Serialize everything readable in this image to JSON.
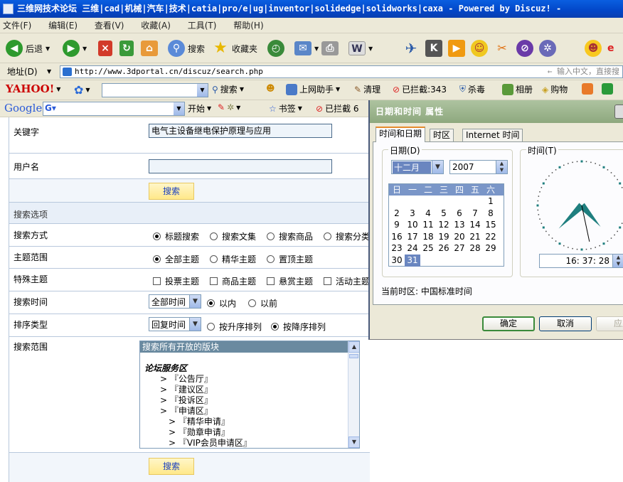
{
  "window": {
    "title": "三维网技术论坛 三维|cad|机械|汽车|技术|catia|pro/e|ug|inventor|solidedge|solidworks|caxa - Powered by Discuz! -"
  },
  "menu": {
    "items": [
      "文件(F)",
      "编辑(E)",
      "查看(V)",
      "收藏(A)",
      "工具(T)",
      "帮助(H)"
    ]
  },
  "toolbar": {
    "back": "后退",
    "search": "搜索",
    "favorites": "收藏夹"
  },
  "address": {
    "label": "地址(D)",
    "url": "http://www.3dportal.cn/discuz/search.php",
    "hint": "输入中文，直接搜"
  },
  "yahoo": {
    "logo": "YAHOO!",
    "search": "搜索",
    "assistant": "上网助手",
    "clean": "清理",
    "blocked": "已拦截:343",
    "antivirus": "杀毒",
    "album": "相册",
    "shop": "购物"
  },
  "google": {
    "logo": "Google",
    "start": "开始",
    "bookmarks": "书签",
    "blocked": "已拦截 6"
  },
  "form": {
    "keyword_label": "关键字",
    "keyword_value": "电气主设备继电保护原理与应用",
    "username_label": "用户名",
    "username_value": "",
    "search_button": "搜索",
    "options_heading": "搜索选项",
    "method_label": "搜索方式",
    "method_options": [
      "标题搜索",
      "搜索文集",
      "搜索商品",
      "搜索分类"
    ],
    "scope_label": "主题范围",
    "scope_options": [
      "全部主题",
      "精华主题",
      "置顶主题"
    ],
    "special_label": "特殊主题",
    "special_options": [
      "投票主题",
      "商品主题",
      "悬赏主题",
      "活动主题"
    ],
    "time_label": "搜索时间",
    "time_value": "全部时间",
    "time_within": "以内",
    "time_before": "以前",
    "sort_label": "排序类型",
    "sort_value": "回复时间",
    "sort_asc": "按升序排列",
    "sort_desc": "按降序排列",
    "range_label": "搜索范围",
    "range_list": {
      "header": "搜索所有开放的版块",
      "group": "论坛服务区",
      "items": [
        "> 『公告厅』",
        "> 『建议区』",
        "> 『投诉区』",
        "> 『申请区』"
      ],
      "subitems": [
        "> 『精华申请』",
        "> 『勋章申请』",
        "> 『VIP会员申请区』"
      ]
    },
    "bottom_button": "搜索"
  },
  "dialog": {
    "title": "日期和时间 属性",
    "tabs": [
      "时间和日期",
      "时区",
      "Internet 时间"
    ],
    "date_group": "日期(D)",
    "month": "十二月",
    "year": "2007",
    "weekdays": [
      "日",
      "一",
      "二",
      "三",
      "四",
      "五",
      "六"
    ],
    "weeks": [
      [
        "",
        "",
        "",
        "",
        "",
        "",
        "1"
      ],
      [
        "2",
        "3",
        "4",
        "5",
        "6",
        "7",
        "8"
      ],
      [
        "9",
        "10",
        "11",
        "12",
        "13",
        "14",
        "15"
      ],
      [
        "16",
        "17",
        "18",
        "19",
        "20",
        "21",
        "22"
      ],
      [
        "23",
        "24",
        "25",
        "26",
        "27",
        "28",
        "29"
      ],
      [
        "30",
        "31",
        "",
        "",
        "",
        "",
        ""
      ]
    ],
    "today": "31",
    "time_group": "时间(T)",
    "time_value": "16: 37: 28",
    "timezone_text": "当前时区: 中国标准时间",
    "ok": "确定",
    "cancel": "取消",
    "apply": "应用"
  }
}
